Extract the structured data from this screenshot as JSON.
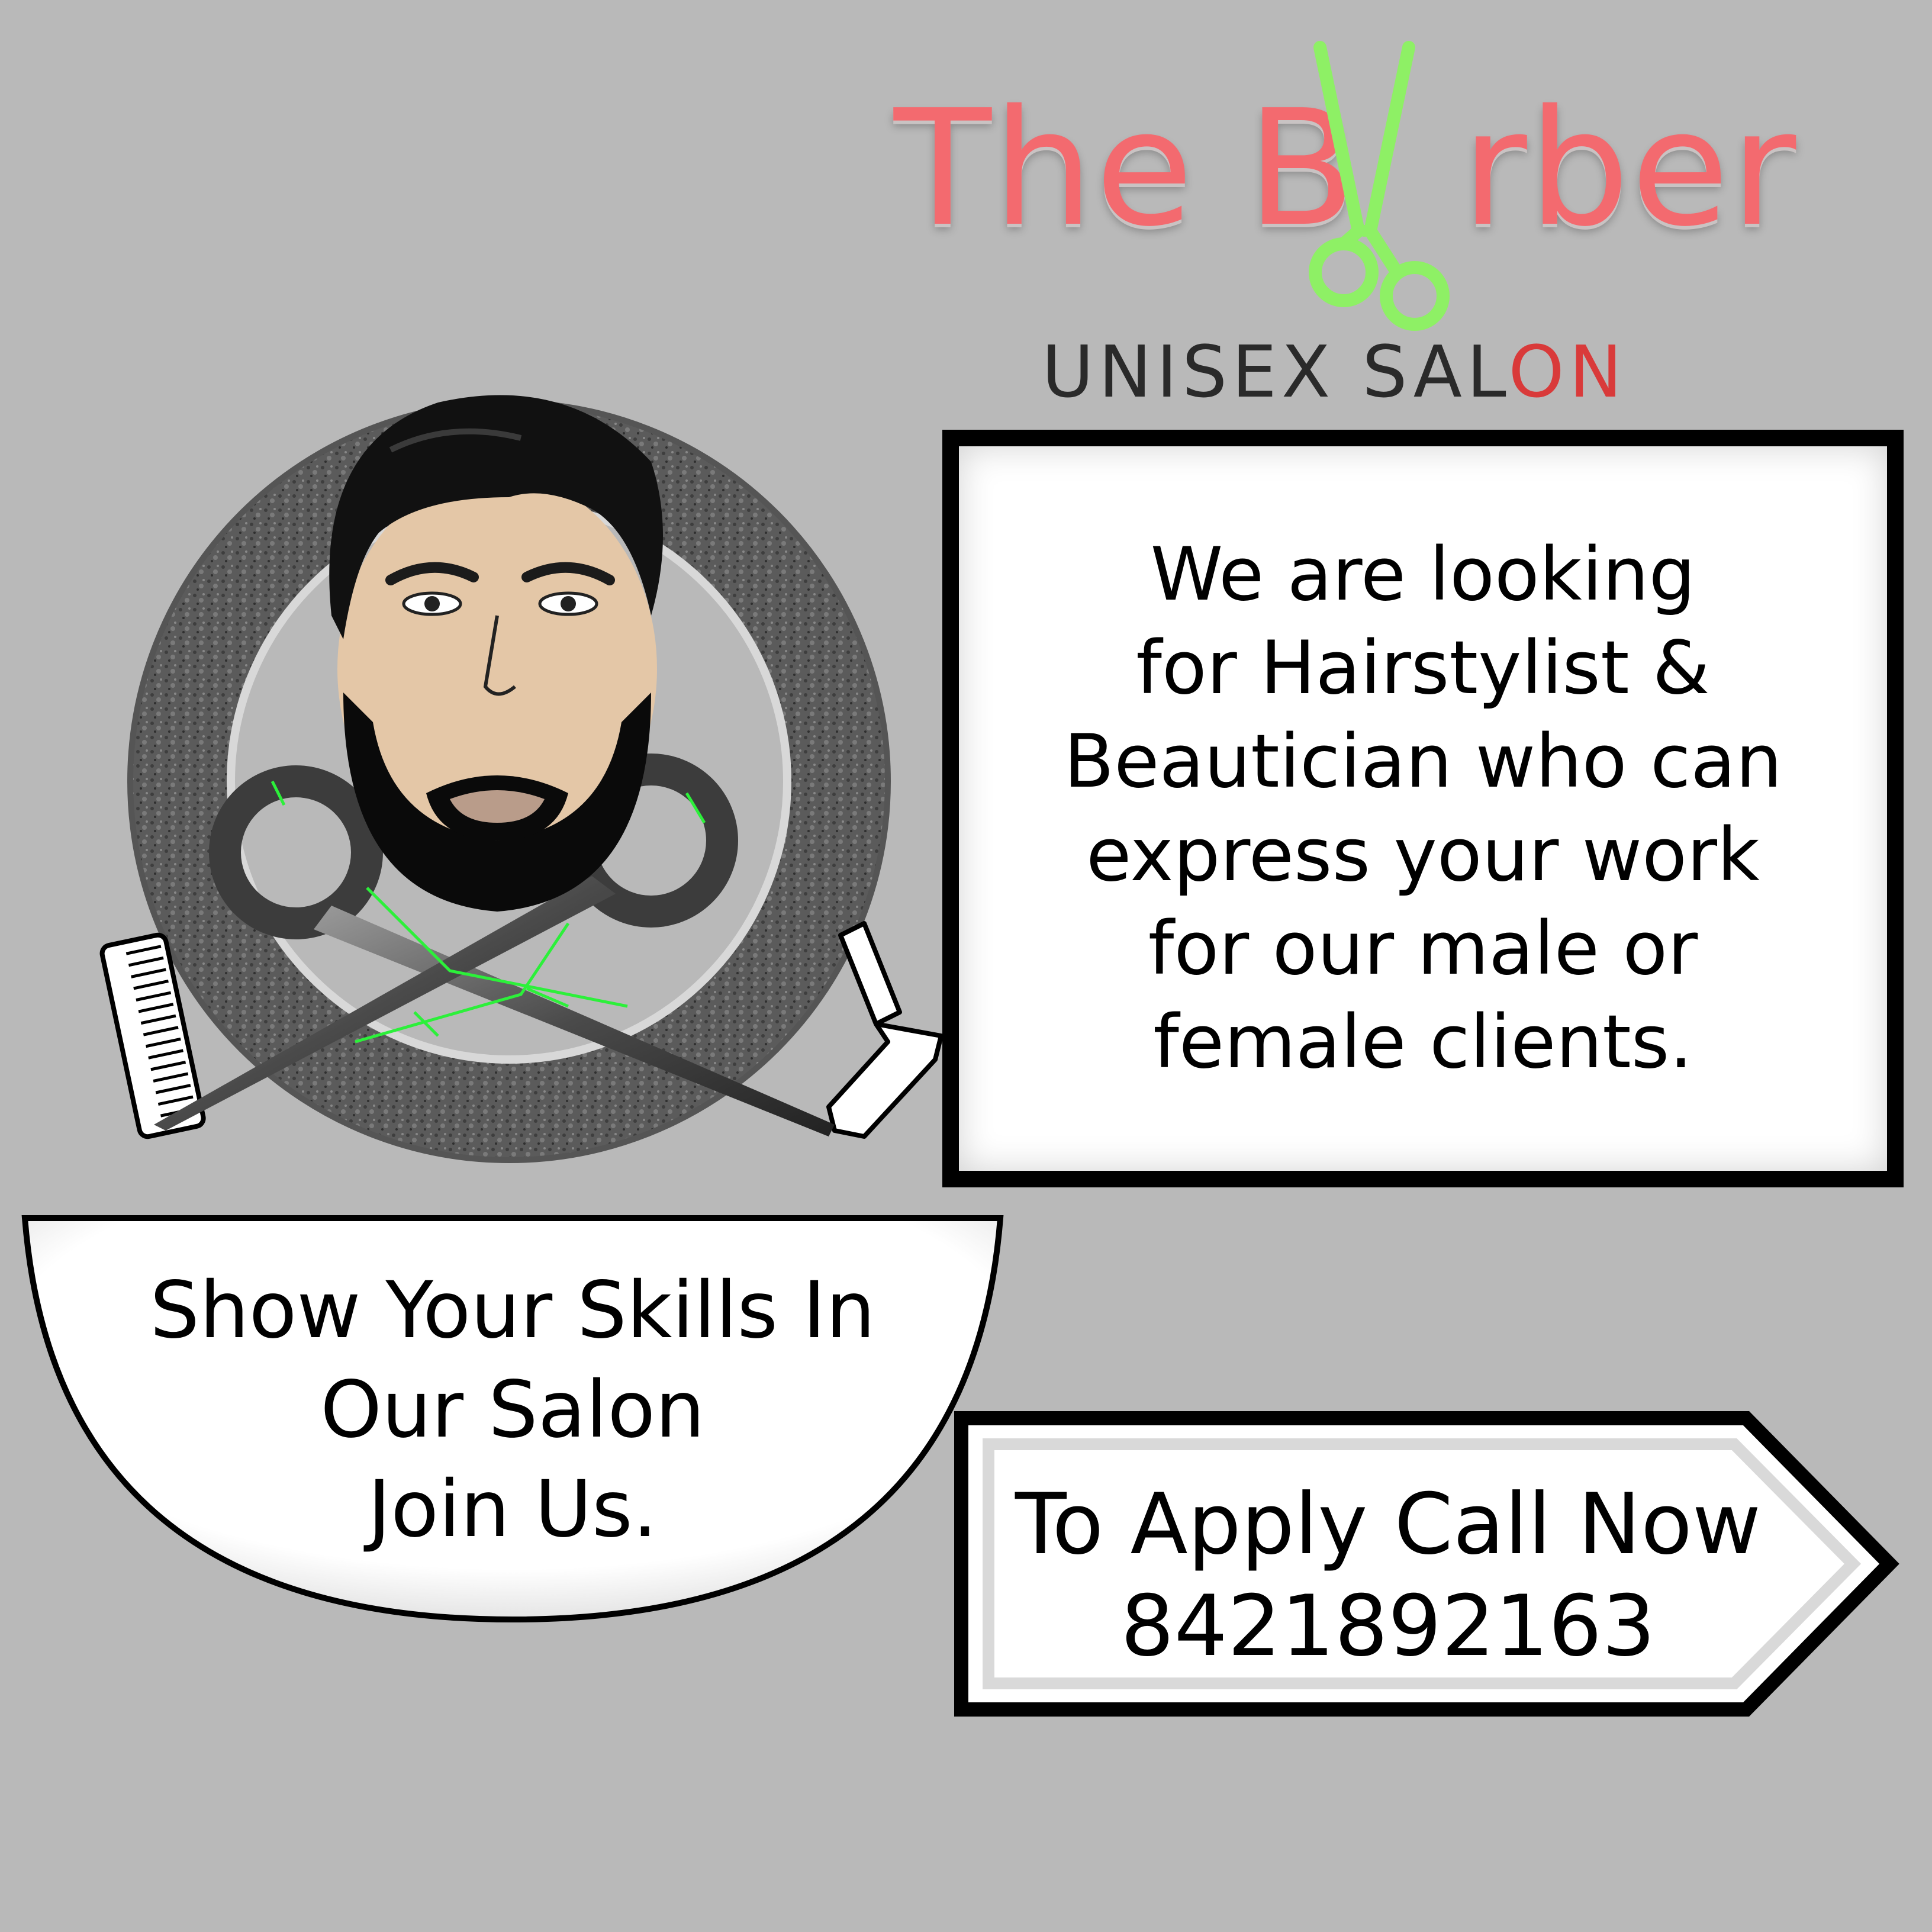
{
  "brand": {
    "title": "The B  rber",
    "subtitle_main": "UNISEX SAL",
    "subtitle_accent": "ON",
    "title_color": "#f36a6f",
    "scissors_color": "#8ef065",
    "accent_color": "#d93a3a"
  },
  "message": {
    "lines": [
      "We are looking",
      "for Hairstylist &",
      "Beautician who can",
      "express your work",
      "for our male or",
      "female clients."
    ]
  },
  "skills": {
    "lines": [
      "Show Your Skills In",
      "Our Salon",
      "Join Us."
    ]
  },
  "call": {
    "label": "To Apply Call Now",
    "phone": "8421892163"
  },
  "emblem": {
    "icons": [
      "barber-face-icon",
      "scissors-icon",
      "comb-icon",
      "razor-icon"
    ]
  }
}
